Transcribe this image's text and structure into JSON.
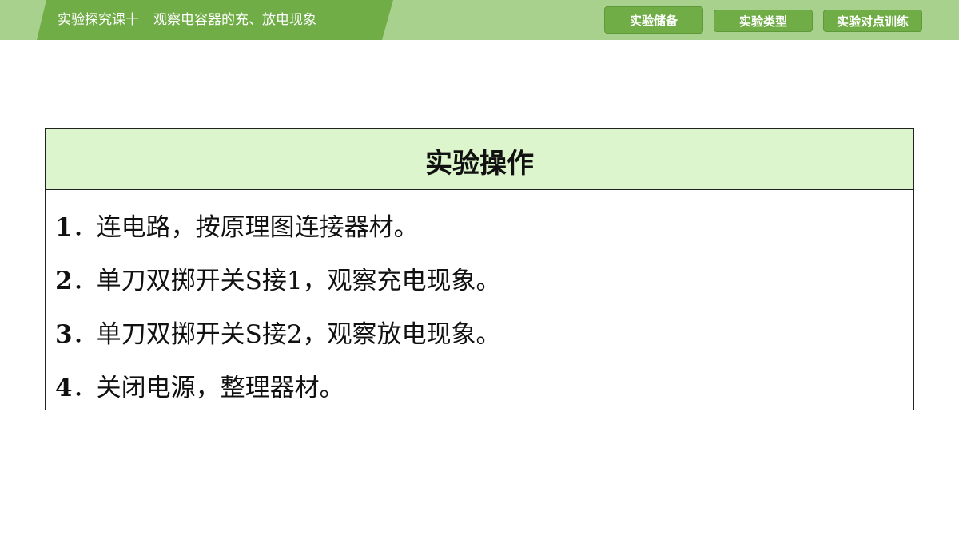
{
  "header": {
    "course": "实验探究课十",
    "topic": "观察电容器的充、放电现象"
  },
  "nav": [
    {
      "label": "实验储备",
      "active": true
    },
    {
      "label": "实验类型",
      "active": false
    },
    {
      "label": "实验对点训练",
      "active": false
    }
  ],
  "card": {
    "title": "实验操作",
    "steps": [
      {
        "num": "1",
        "text": "连电路，按原理图连接器材。"
      },
      {
        "num": "2",
        "text": "单刀双掷开关S接1，观察充电现象。"
      },
      {
        "num": "3",
        "text": "单刀双掷开关S接2，观察放电现象。"
      },
      {
        "num": "4",
        "text": "关闭电源，整理器材。"
      }
    ]
  },
  "colors": {
    "bar": "#a9d18e",
    "accent": "#70ad47",
    "header_fill": "#dcf5cc"
  }
}
